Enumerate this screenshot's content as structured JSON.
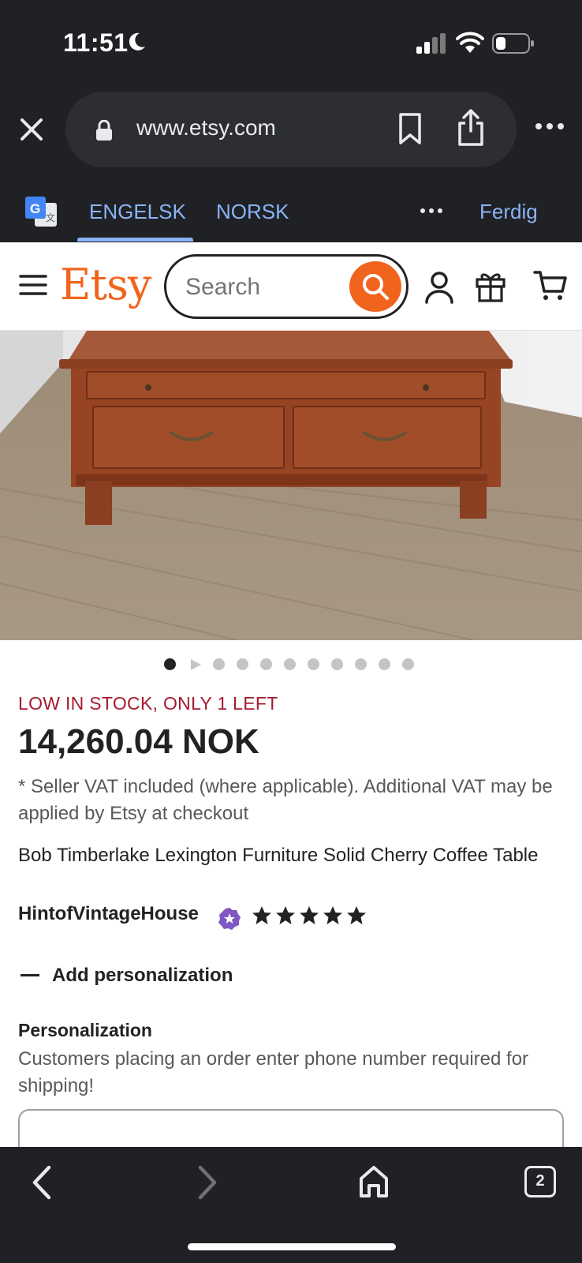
{
  "status_bar": {
    "time": "11:51",
    "icons": [
      "moon-icon",
      "signal-icon",
      "wifi-icon",
      "battery-icon"
    ]
  },
  "browser": {
    "url": "www.etsy.com",
    "icons": [
      "close-icon",
      "lock-icon",
      "bookmark-icon",
      "share-icon",
      "more-icon"
    ]
  },
  "translate_bar": {
    "source_lang": "ENGELSK",
    "target_lang": "NORSK",
    "done_label": "Ferdig",
    "accent_color": "#8ab4f8"
  },
  "etsy_header": {
    "logo": "Etsy",
    "search_placeholder": "Search",
    "brand_color": "#f1641e",
    "icons": [
      "menu-icon",
      "search-icon",
      "user-icon",
      "gift-icon",
      "cart-icon"
    ]
  },
  "product": {
    "carousel_dot_count": 11,
    "carousel_active_index": 0,
    "stock_notice": "LOW IN STOCK, ONLY 1 LEFT",
    "price": "14,260.04 NOK",
    "vat_note": "* Seller VAT included (where applicable). Additional VAT may be applied by Etsy at checkout",
    "title": "Bob Timberlake Lexington Furniture Solid Cherry Coffee Table",
    "shop_name": "HintofVintageHouse",
    "star_rating": 5,
    "stock_color": "#a61a2e"
  },
  "personalization": {
    "toggle_label": "Add personalization",
    "label": "Personalization",
    "description": "Customers placing an order enter phone number required for shipping!"
  },
  "bottom_nav": {
    "tab_count": "2",
    "icons": [
      "back-arrow-icon",
      "forward-arrow-icon",
      "home-icon",
      "tabs-icon"
    ]
  }
}
